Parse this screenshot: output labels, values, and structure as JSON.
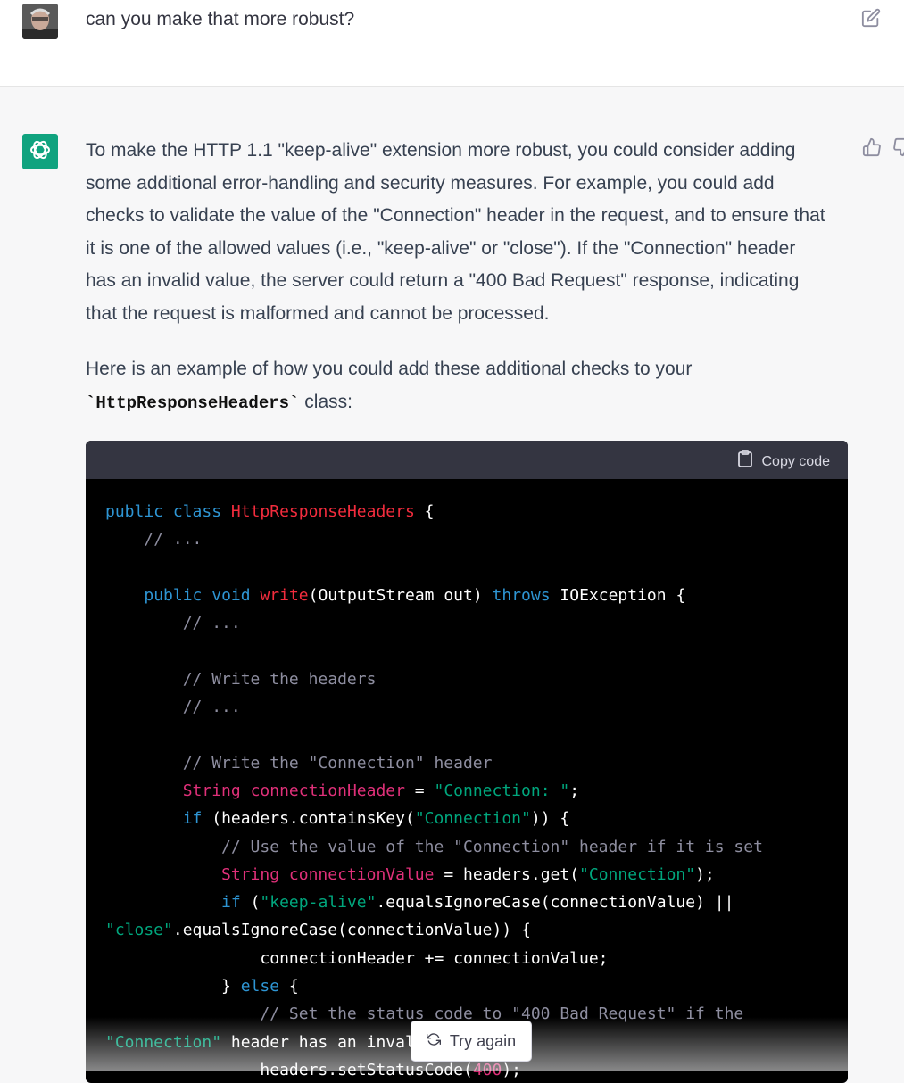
{
  "user_message": {
    "text": "can you make that more robust?"
  },
  "assistant_message": {
    "paragraph1": "To make the HTTP 1.1 \"keep-alive\" extension more robust, you could consider adding some additional error-handling and security measures. For example, you could add checks to validate the value of the \"Connection\" header in the request, and to ensure that it is one of the allowed values (i.e., \"keep-alive\" or \"close\"). If the \"Connection\" header has an invalid value, the server could return a \"400 Bad Request\" response, indicating that the request is malformed and cannot be processed.",
    "paragraph2_prefix": "Here is an example of how you could add these additional checks to your",
    "paragraph2_code": "`HttpResponseHeaders`",
    "paragraph2_suffix": " class:"
  },
  "code_block": {
    "copy_label": "Copy code",
    "lines": [
      "public class HttpResponseHeaders {",
      "    // ...",
      "",
      "    public void write(OutputStream out) throws IOException {",
      "        // ...",
      "",
      "        // Write the headers",
      "        // ...",
      "",
      "        // Write the \"Connection\" header",
      "        String connectionHeader = \"Connection: \";",
      "        if (headers.containsKey(\"Connection\")) {",
      "            // Use the value of the \"Connection\" header if it is set",
      "            String connectionValue = headers.get(\"Connection\");",
      "            if (\"keep-alive\".equalsIgnoreCase(connectionValue) ||",
      "\"close\".equalsIgnoreCase(connectionValue)) {",
      "                connectionHeader += connectionValue;",
      "            } else {",
      "                // Set the status code to \"400 Bad Request\" if the",
      "\"Connection\" header has an invalid value",
      "                headers.setStatusCode(400);"
    ]
  },
  "try_again_label": "Try again",
  "icons": {
    "edit": "edit-icon",
    "thumbs_up": "thumbs-up-icon",
    "thumbs_down": "thumbs-down-icon",
    "clipboard": "clipboard-icon",
    "refresh": "refresh-icon",
    "openai_logo": "openai-logo-icon"
  },
  "colors": {
    "assistant_avatar": "#10a37f",
    "code_keyword": "#2e95d3",
    "code_class": "#f22c3d",
    "code_string": "#00a67d",
    "code_comment": "#8e8ea0"
  }
}
